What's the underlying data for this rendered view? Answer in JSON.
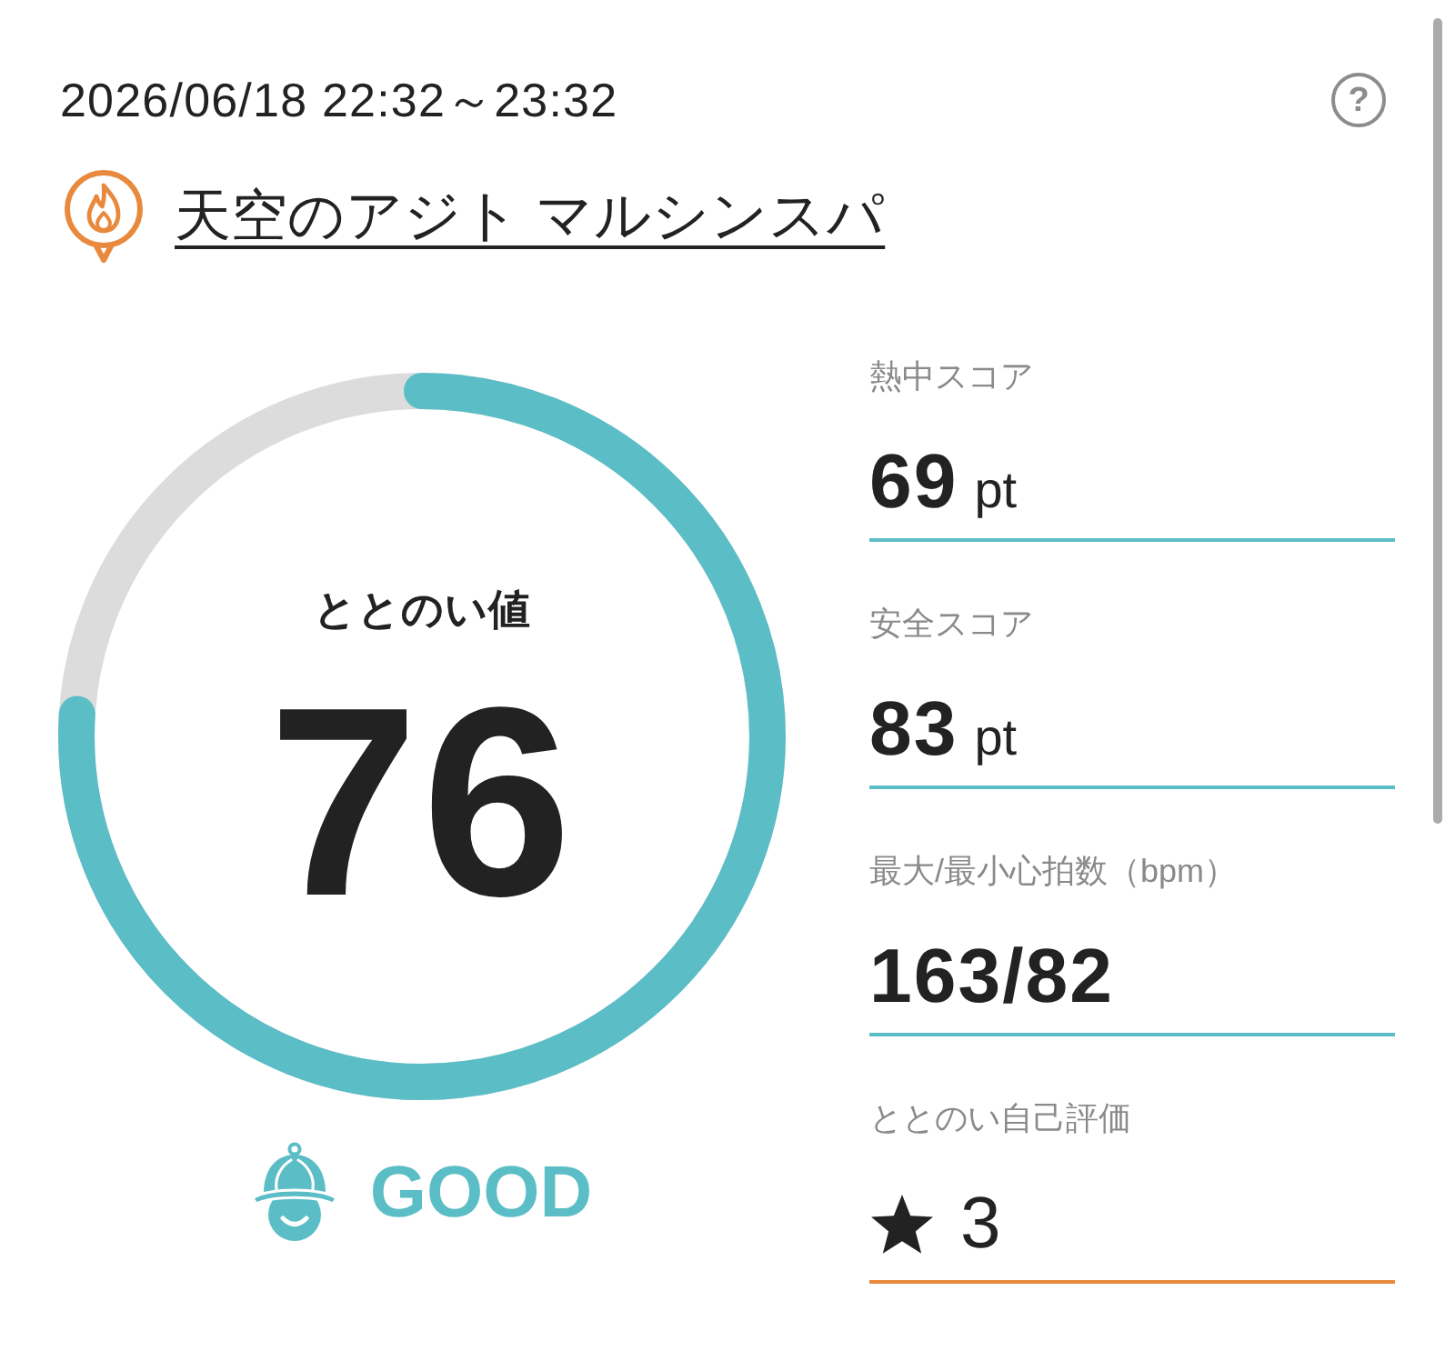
{
  "header": {
    "datetime": "2026/06/18 22:32～23:32",
    "help": "?"
  },
  "facility": {
    "name": "天空のアジト マルシンスパ"
  },
  "gauge": {
    "label": "ととのい値",
    "value": "76",
    "level": 0.76
  },
  "status": {
    "label": "GOOD"
  },
  "metrics": [
    {
      "kind": "score",
      "label": "熱中スコア",
      "value": "69",
      "unit": "pt"
    },
    {
      "kind": "score",
      "label": "安全スコア",
      "value": "83",
      "unit": "pt"
    },
    {
      "kind": "plain",
      "label": "最大/最小心拍数（bpm）",
      "value": "163/82"
    },
    {
      "kind": "rating",
      "label": "ととのい自己評価",
      "value": "3"
    }
  ]
}
